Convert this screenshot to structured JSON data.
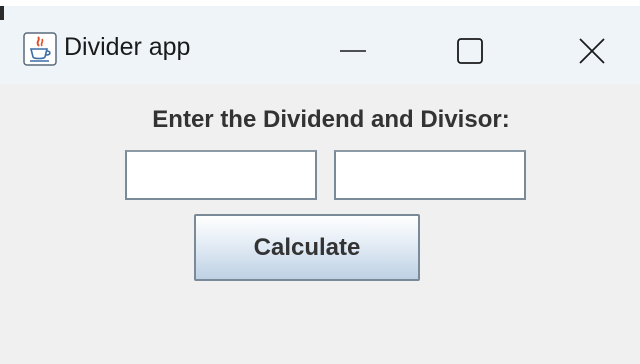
{
  "window": {
    "title": "Divider app",
    "app_icon": "java-cup-icon",
    "controls": {
      "minimize_icon": "minimize-icon",
      "maximize_icon": "maximize-icon",
      "close_icon": "close-icon"
    }
  },
  "form": {
    "prompt": "Enter the Dividend and Divisor:",
    "dividend_value": "",
    "divisor_value": "",
    "calculate_label": "Calculate"
  },
  "colors": {
    "titlebar": "#eff4f9",
    "content_background": "#f0f0f0",
    "text": "#333333",
    "button_gradient_bottom": "#bed1e4"
  }
}
